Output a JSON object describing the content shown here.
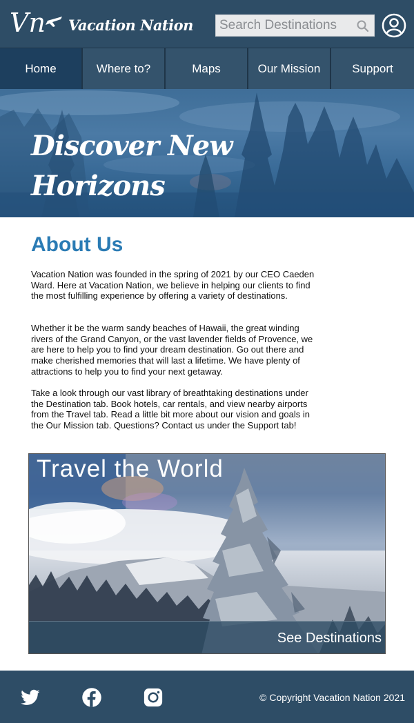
{
  "header": {
    "logo_mark": "Vn",
    "brand_name": "Vacation Nation",
    "search": {
      "placeholder": "Search Destinations",
      "value": ""
    }
  },
  "nav": {
    "items": [
      {
        "label": "Home",
        "active": true
      },
      {
        "label": "Where to?"
      },
      {
        "label": "Maps"
      },
      {
        "label": "Our Mission"
      },
      {
        "label": "Support"
      }
    ]
  },
  "hero": {
    "title_line1": "Discover New",
    "title_line2": "Horizons"
  },
  "about": {
    "title": "About Us",
    "paragraphs": [
      "Vacation Nation was founded in the spring of 2021 by our CEO Caeden Ward. Here at Vacation Nation, we believe in helping our clients to find the most fulfilling experience by offering a variety of destinations.",
      "Whether it be the warm sandy beaches of Hawaii, the great winding rivers of the Grand Canyon, or the vast lavender fields of Provence, we are here to help you to find your dream destination. Go out there and make cherished memories that will last a lifetime. We have plenty of attractions to help you to find your next getaway.",
      "Take a look through our vast library of breathtaking destinations under the Destination tab. Book hotels, car rentals, and view nearby airports from the Travel tab. Read a little bit more about our vision and goals in the Our Mission tab. Questions? Contact us under the Support tab!"
    ]
  },
  "feature": {
    "title": "Travel the World",
    "link_label": "See Destinations"
  },
  "footer": {
    "copyright": "© Copyright Vacation Nation 2021",
    "social_icons": [
      "twitter-icon",
      "facebook-icon",
      "instagram-icon"
    ]
  },
  "colors": {
    "header_bg": "#2e4d66",
    "nav_active": "#1d3f5e",
    "accent_blue": "#2a7bb4",
    "footer_bg": "#2e4d66"
  }
}
